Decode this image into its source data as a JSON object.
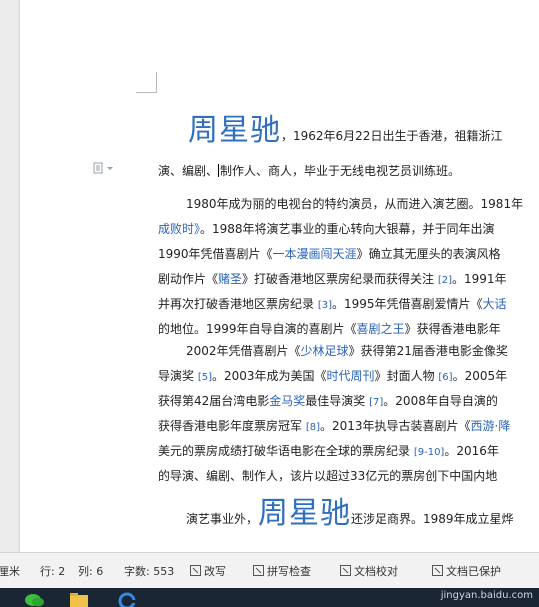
{
  "document": {
    "heading_name": "周星驰",
    "intro_line1": "，1962年6月22日出生于香港，祖籍浙江",
    "intro_line2_a": "演、编剧、",
    "intro_line2_b": "制作人、商人，毕业于无线电视艺员训练班。",
    "p1": [
      {
        "segs": [
          {
            "t": "1980年成为丽的电视台的特约演员，从而进入演艺圈。1981年"
          }
        ]
      },
      {
        "segs": [
          {
            "t": "成败时》",
            "link": true
          },
          {
            "t": "。1988年将演艺事业的重心转向大银幕，并于同年出演"
          }
        ]
      },
      {
        "segs": [
          {
            "t": "1990年凭借喜剧片《"
          },
          {
            "t": "一本漫画闯天涯",
            "link": true
          },
          {
            "t": "》确立其无厘头的表演风格"
          }
        ]
      },
      {
        "segs": [
          {
            "t": "剧动作片《"
          },
          {
            "t": "赌圣",
            "link": true
          },
          {
            "t": "》打破香港地区票房纪录而获得关注 "
          },
          {
            "t": "[2]",
            "ref": true
          },
          {
            "t": "。1991年"
          }
        ]
      },
      {
        "segs": [
          {
            "t": "并再次打破香港地区票房纪录 "
          },
          {
            "t": "[3]",
            "ref": true
          },
          {
            "t": "。1995年凭借喜剧爱情片《"
          },
          {
            "t": "大话",
            "link": true
          }
        ]
      },
      {
        "segs": [
          {
            "t": "的地位。1999年自导自演的喜剧片《"
          },
          {
            "t": "喜剧之王",
            "link": true
          },
          {
            "t": "》获得香港电影年"
          }
        ]
      }
    ],
    "p2": [
      {
        "segs": [
          {
            "t": "2002年凭借喜剧片《"
          },
          {
            "t": "少林足球",
            "link": true
          },
          {
            "t": "》获得第21届香港电影金像奖"
          }
        ]
      },
      {
        "segs": [
          {
            "t": "导演奖 "
          },
          {
            "t": "[5]",
            "ref": true
          },
          {
            "t": "。2003年成为美国《"
          },
          {
            "t": "时代周刊",
            "link": true
          },
          {
            "t": "》封面人物 "
          },
          {
            "t": "[6]",
            "ref": true
          },
          {
            "t": "。2005年"
          }
        ]
      },
      {
        "segs": [
          {
            "t": "获得第42届台湾电影"
          },
          {
            "t": "金马奖",
            "link": true
          },
          {
            "t": "最佳导演奖 "
          },
          {
            "t": "[7]",
            "ref": true
          },
          {
            "t": "。2008年自导自演的"
          }
        ]
      },
      {
        "segs": [
          {
            "t": "获得香港电影年度票房冠军 "
          },
          {
            "t": "[8]",
            "ref": true
          },
          {
            "t": "。2013年执导古装喜剧片《"
          },
          {
            "t": "西游·降",
            "link": true
          }
        ]
      },
      {
        "segs": [
          {
            "t": "美元的票房成绩打破华语电影在全球的票房纪录 "
          },
          {
            "t": "[9-10]",
            "ref": true
          },
          {
            "t": "。2016年"
          }
        ]
      },
      {
        "segs": [
          {
            "t": "的导演、编剧、制作人，该片以超过33亿元的票房创下中国内地"
          }
        ]
      }
    ],
    "p3_prefix": "演艺事业外，",
    "p3_name": "周星驰",
    "p3_suffix": "还涉足商界。1989年成立星烨"
  },
  "statusbar": {
    "unit": "厘米",
    "row": "行: 2",
    "col": "列: 6",
    "wordcount": "字数: 553",
    "revise": "改写",
    "spellcheck": "拼写检查",
    "proofread": "文档校对",
    "backup": "文档已保护"
  },
  "watermark": "jingyan.baidu.com",
  "colors": {
    "heading": "#2e6fbf",
    "link": "#2a63b8",
    "taskbar": "#1b2635"
  }
}
